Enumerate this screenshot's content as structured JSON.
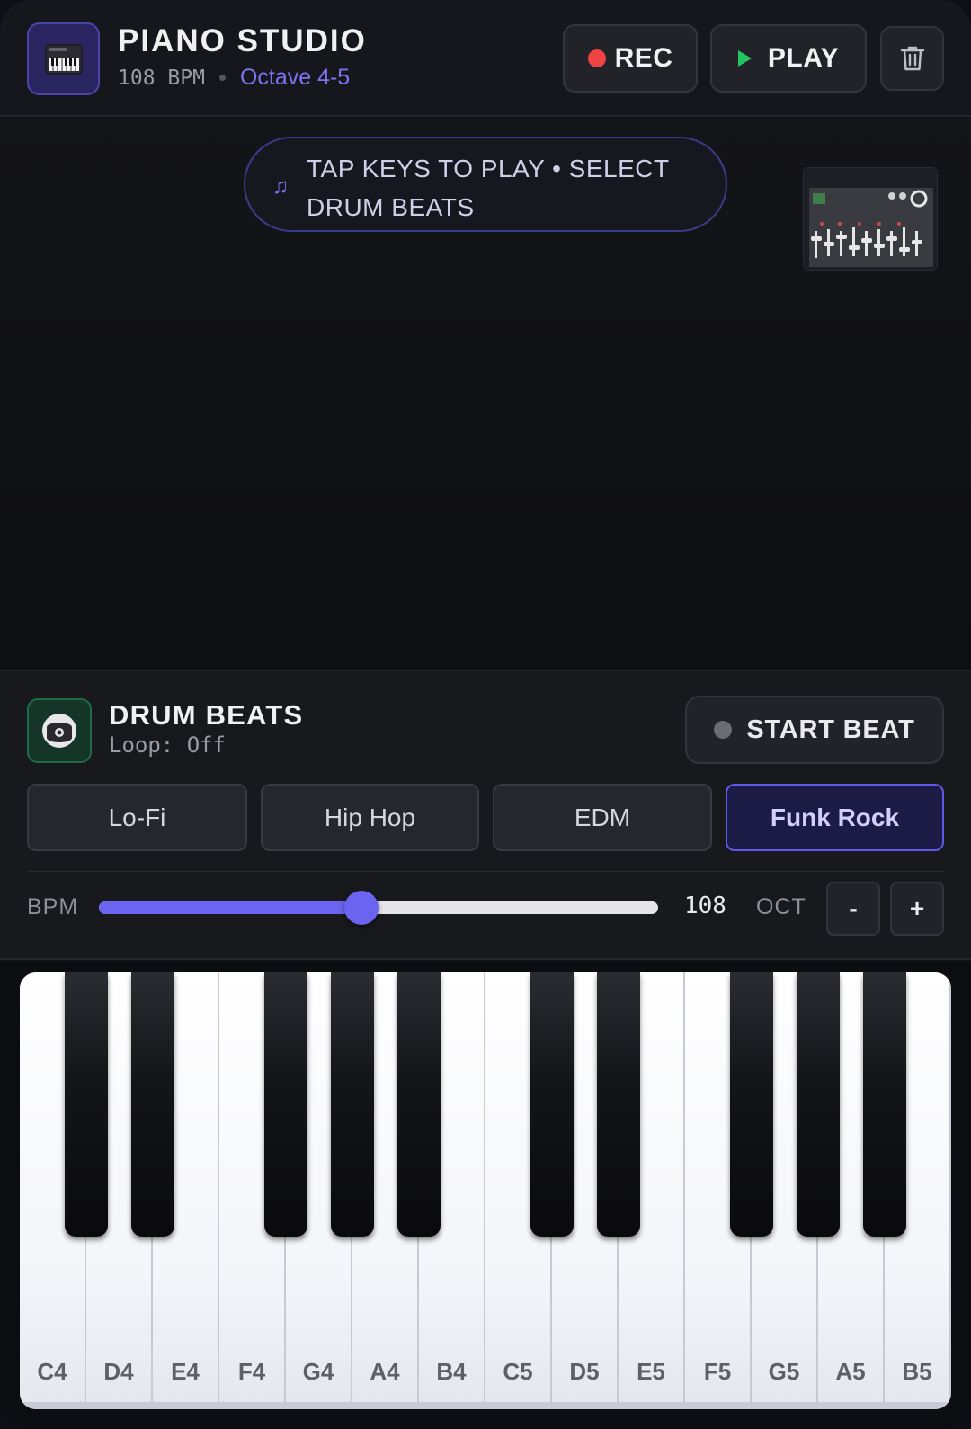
{
  "header": {
    "title": "PIANO STUDIO",
    "bpm_text": "108 BPM",
    "octave_text": "Octave 4-5",
    "rec_label": "REC",
    "play_label": "PLAY"
  },
  "stage": {
    "hint_text": "TAP KEYS TO PLAY • SELECT DRUM BEATS"
  },
  "drum": {
    "title": "DRUM BEATS",
    "loop_text": "Loop: Off",
    "start_label": "START BEAT",
    "presets": [
      "Lo-Fi",
      "Hip Hop",
      "EDM",
      "Funk Rock"
    ],
    "active_preset": "Funk Rock"
  },
  "controls": {
    "bpm_label": "BPM",
    "bpm_value": "108",
    "bpm_fraction": 0.47,
    "oct_label": "OCT",
    "oct_minus": "-",
    "oct_plus": "+"
  },
  "keyboard": {
    "white_keys": [
      "C4",
      "D4",
      "E4",
      "F4",
      "G4",
      "A4",
      "B4",
      "C5",
      "D5",
      "E5",
      "F5",
      "G5",
      "A5",
      "B5"
    ]
  },
  "colors": {
    "accent": "#6b64f0",
    "rec": "#ef4444",
    "play": "#22c55e"
  }
}
